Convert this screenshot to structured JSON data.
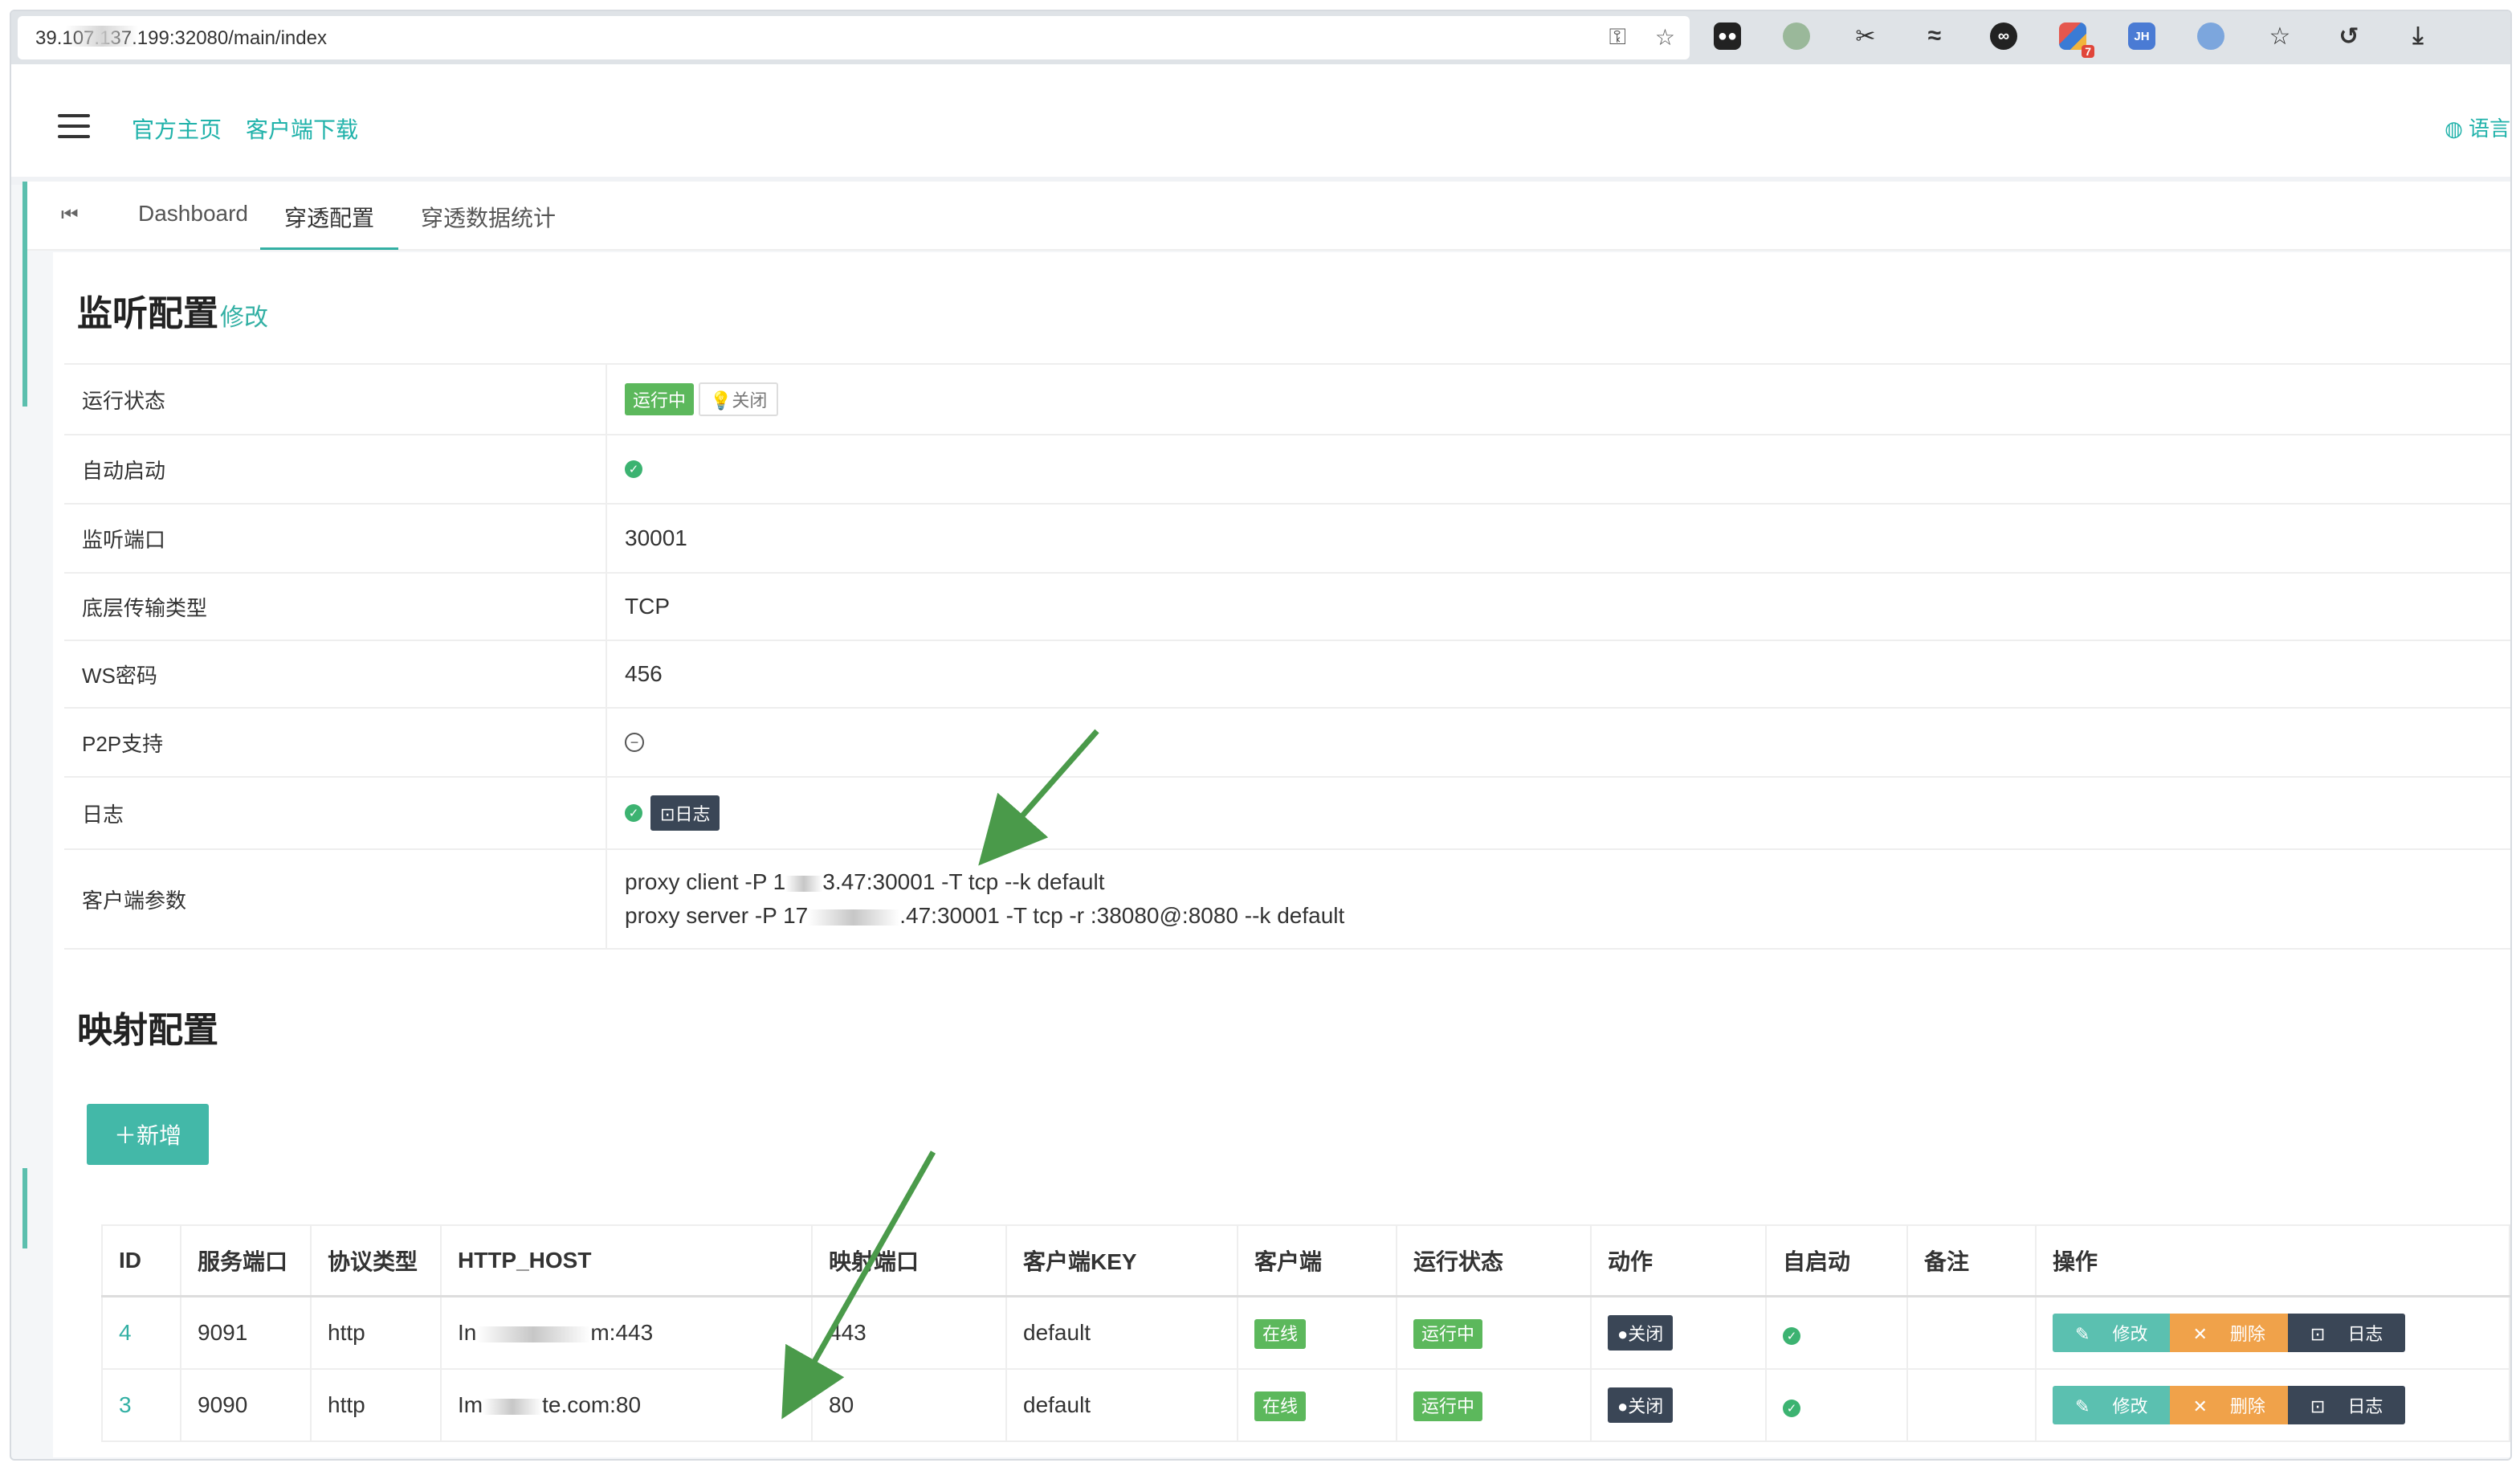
{
  "browser": {
    "url": "39.107.137.199:32080/main/index"
  },
  "header": {
    "links": [
      "官方主页",
      "客户端下载"
    ],
    "language": "语言"
  },
  "tabs": {
    "items": [
      "Dashboard",
      "穿透配置",
      "穿透数据统计"
    ],
    "active": "穿透配置"
  },
  "listen": {
    "title": "监听配置",
    "edit": "修改",
    "rows": [
      {
        "label": "运行状态"
      },
      {
        "label": "自动启动"
      },
      {
        "label": "监听端口",
        "value": "30001"
      },
      {
        "label": "底层传输类型",
        "value": "TCP"
      },
      {
        "label": "WS密码",
        "value": "456"
      },
      {
        "label": "P2P支持"
      },
      {
        "label": "日志"
      },
      {
        "label": "客户端参数"
      }
    ],
    "status_running": "运行中",
    "close_button": "关闭",
    "log_button": "日志",
    "client_param_1_prefix": "proxy client -P 1",
    "client_param_1_suffix": "3.47:30001 -T tcp --k default",
    "client_param_2_prefix": "proxy server -P 17",
    "client_param_2_suffix": ".47:30001 -T tcp -r :38080@:8080 --k default"
  },
  "mapping": {
    "title": "映射配置",
    "add_button": "新增",
    "columns": [
      "ID",
      "服务端口",
      "协议类型",
      "HTTP_HOST",
      "映射端口",
      "客户端KEY",
      "客户端",
      "运行状态",
      "动作",
      "自启动",
      "备注",
      "操作"
    ],
    "rows": [
      {
        "id": "4",
        "port": "9091",
        "protocol": "http",
        "host_prefix": "In",
        "host_suffix": "m:443",
        "map_port": "443",
        "key": "default",
        "client": "在线",
        "status": "运行中",
        "action": "关闭",
        "remark": ""
      },
      {
        "id": "3",
        "port": "9090",
        "protocol": "http",
        "host_prefix": "Im",
        "host_suffix": "te.com:80",
        "map_port": "80",
        "key": "default",
        "client": "在线",
        "status": "运行中",
        "action": "关闭",
        "remark": ""
      }
    ],
    "op_edit": "修改",
    "op_delete": "删除",
    "op_log": "日志"
  },
  "colors": {
    "accent": "#33b0a4",
    "success": "#5cb85c",
    "dark_button": "#3a4656",
    "warning": "#f0a24a",
    "arrow": "#4a9a4a"
  }
}
